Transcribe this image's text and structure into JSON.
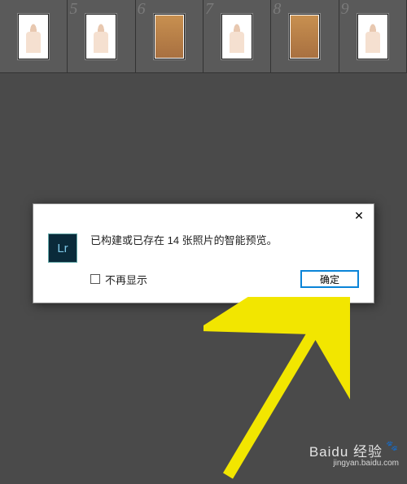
{
  "filmstrip": {
    "start_number": 5,
    "thumbs": [
      {
        "num": "",
        "variant": "a"
      },
      {
        "num": "5",
        "variant": "a"
      },
      {
        "num": "6",
        "variant": "b"
      },
      {
        "num": "7",
        "variant": "a"
      },
      {
        "num": "8",
        "variant": "b"
      },
      {
        "num": "9",
        "variant": "a"
      }
    ]
  },
  "dialog": {
    "close_glyph": "✕",
    "icon_text": "Lr",
    "message": "已构建或已存在 14 张照片的智能预览。",
    "checkbox_label": "不再显示",
    "ok_label": "确定"
  },
  "watermark": {
    "main": "Baidu 经验",
    "sub": "jingyan.baidu.com"
  }
}
